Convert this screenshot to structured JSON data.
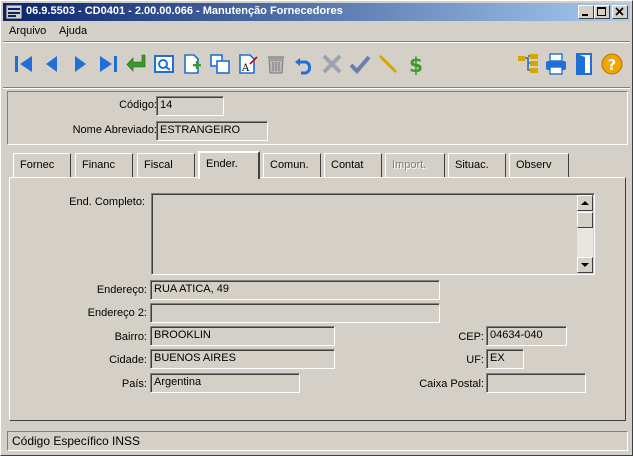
{
  "window": {
    "title": "06.9.5503 - CD0401 - 2.00.00.066 - Manutenção Fornecedores"
  },
  "menu": {
    "items": [
      {
        "label": "Arquivo"
      },
      {
        "label": "Ajuda"
      }
    ]
  },
  "toolbar": {
    "icons": [
      "first-record-icon",
      "previous-record-icon",
      "next-record-icon",
      "last-record-icon",
      "go-to-icon",
      "search-icon",
      "new-record-icon",
      "copy-record-icon",
      "edit-record-icon",
      "delete-record-icon",
      "undo-icon",
      "cancel-icon",
      "confirm-icon",
      "pencil-icon",
      "dollar-icon",
      "tree-icon",
      "print-icon",
      "exit-icon",
      "help-icon"
    ]
  },
  "header": {
    "codigo_label": "Código:",
    "codigo_value": "14",
    "nome_label": "Nome Abreviado:",
    "nome_value": "ESTRANGEIRO"
  },
  "tabs": [
    {
      "label": "Fornec"
    },
    {
      "label": "Financ"
    },
    {
      "label": "Fiscal"
    },
    {
      "label": "Ender."
    },
    {
      "label": "Comun."
    },
    {
      "label": "Contat"
    },
    {
      "label": "Import."
    },
    {
      "label": "Situac."
    },
    {
      "label": "Observ"
    }
  ],
  "address": {
    "end_completo_label": "End. Completo:",
    "end_completo_value": "",
    "endereco_label": "Endereço:",
    "endereco_value": "RUA ATICA, 49",
    "endereco2_label": "Endereço 2:",
    "endereco2_value": "",
    "bairro_label": "Bairro:",
    "bairro_value": "BROOKLIN",
    "cep_label": "CEP:",
    "cep_value": "04634-040",
    "cidade_label": "Cidade:",
    "cidade_value": "BUENOS AIRES",
    "uf_label": "UF:",
    "uf_value": "EX",
    "pais_label": "País:",
    "pais_value": "Argentina",
    "caixa_label": "Caixa Postal:",
    "caixa_value": ""
  },
  "status": {
    "text": "Código Específico INSS"
  },
  "colors": {
    "title_start": "#0a246a",
    "title_end": "#a6caf0",
    "face": "#d4d0c8",
    "icon_blue": "#1f6fd6",
    "icon_green": "#3c9a2c"
  }
}
